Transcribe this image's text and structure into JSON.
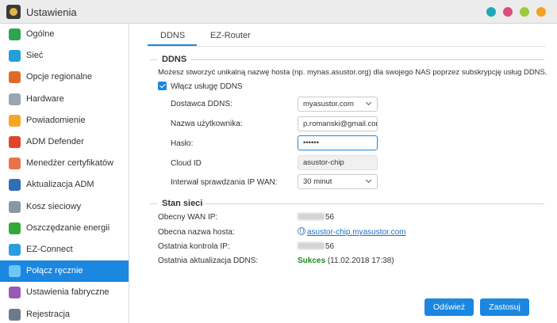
{
  "window": {
    "title": "Ustawienia",
    "icon": "settings-app-icon",
    "controls": [
      {
        "name": "help",
        "color": "#1fa9b8"
      },
      {
        "name": "minimize",
        "color": "#d84f7a"
      },
      {
        "name": "maximize",
        "color": "#9ec83b"
      },
      {
        "name": "close",
        "color": "#f2a31f"
      }
    ]
  },
  "sidebar": {
    "active_index": 12,
    "items": [
      {
        "label": "Ogólne",
        "icon": "general-icon",
        "color": "#2da44e"
      },
      {
        "label": "Sieć",
        "icon": "network-globe-icon",
        "color": "#24a0d8"
      },
      {
        "label": "Opcje regionalne",
        "icon": "regional-icon",
        "color": "#e06a2a"
      },
      {
        "label": "Hardware",
        "icon": "hardware-icon",
        "color": "#9aa4b2"
      },
      {
        "label": "Powiadomienie",
        "icon": "notification-icon",
        "color": "#f5a623"
      },
      {
        "label": "ADM Defender",
        "icon": "defender-firewall-icon",
        "color": "#e0452a"
      },
      {
        "label": "Menedżer certyfikatów",
        "icon": "certificate-icon",
        "color": "#e8734a"
      },
      {
        "label": "Aktualizacja ADM",
        "icon": "adm-update-icon",
        "color": "#2f6fb5"
      },
      {
        "label": "Kosz sieciowy",
        "icon": "recycle-bin-icon",
        "color": "#8a96a3"
      },
      {
        "label": "Oszczędzanie energii",
        "icon": "energy-saving-icon",
        "color": "#35a83a"
      },
      {
        "label": "EZ-Connect",
        "icon": "ez-connect-cloud-icon",
        "color": "#2a9de0"
      },
      {
        "label": "Połącz ręcznie",
        "icon": "manual-connect-icon",
        "color": "#6ec6f5"
      },
      {
        "label": "Ustawienia fabryczne",
        "icon": "factory-reset-icon",
        "color": "#9b59b6"
      },
      {
        "label": "Rejestracja",
        "icon": "registration-icon",
        "color": "#6b7b8c"
      }
    ]
  },
  "tabs": [
    {
      "label": "DDNS"
    },
    {
      "label": "EZ-Router"
    }
  ],
  "ddns": {
    "section_title": "DDNS",
    "description": "Możesz stworzyć unikalną nazwę hosta (np. mynas.asustor.org) dla swojego NAS poprzez subskrypcję usług DDNS.",
    "enable_label": "Włącz usługę DDNS",
    "enabled": true,
    "fields": {
      "provider_label": "Dostawca DDNS:",
      "provider_value": "myasustor.com",
      "username_label": "Nazwa użytkownika:",
      "username_value": "p.romanski@gmail.com",
      "password_label": "Hasło:",
      "password_value": "••••••",
      "cloud_id_label": "Cloud ID",
      "cloud_id_value": "asustor-chip",
      "interval_label": "Interwał sprawdzania IP WAN:",
      "interval_value": "30 minut"
    }
  },
  "network_status": {
    "section_title": "Stan sieci",
    "wan_ip_label": "Obecny WAN IP:",
    "wan_ip_suffix": "56",
    "hostname_label": "Obecna nazwa hosta:",
    "hostname_value": "asustor-chip.myasustor.com",
    "last_check_label": "Ostatnia kontrola IP:",
    "last_check_suffix": "56",
    "last_update_label": "Ostatnia aktualizacja DDNS:",
    "last_update_status": "Sukces",
    "last_update_time": "(11.02.2018 17:38)"
  },
  "buttons": {
    "refresh": "Odśwież",
    "apply": "Zastosuj"
  }
}
